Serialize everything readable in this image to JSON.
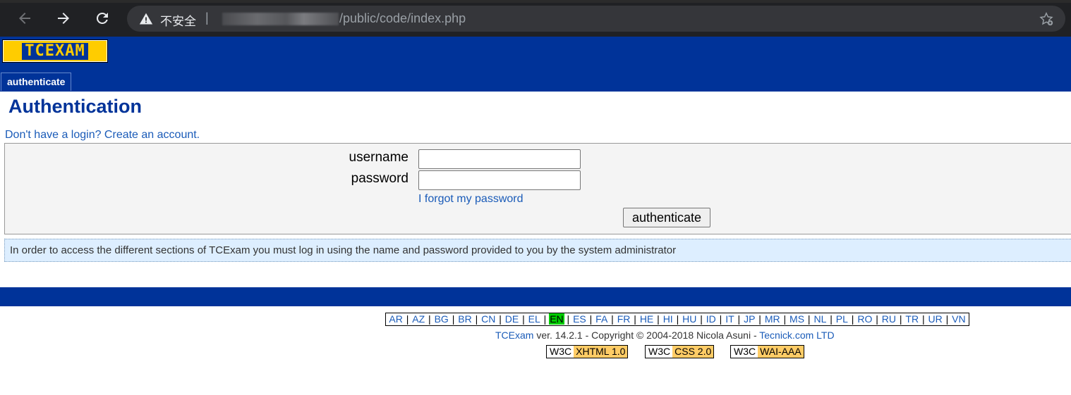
{
  "browser": {
    "security_label": "不安全",
    "separator": "|",
    "url_path": "/public/code/index.php"
  },
  "header": {
    "logo_text": "TCEXAM",
    "menu_tab": "authenticate"
  },
  "main": {
    "title": "Authentication",
    "create_account_link": "Don't have a login? Create an account.",
    "form": {
      "username_label": "username",
      "password_label": "password",
      "username_value": "",
      "password_value": "",
      "forgot_link": "I forgot my password",
      "submit_label": "authenticate"
    },
    "info_message": "In order to access the different sections of TCExam you must log in using the name and password provided to you by the system administrator"
  },
  "footer": {
    "languages": [
      "AR",
      "AZ",
      "BG",
      "BR",
      "CN",
      "DE",
      "EL",
      "EN",
      "ES",
      "FA",
      "FR",
      "HE",
      "HI",
      "HU",
      "ID",
      "IT",
      "JP",
      "MR",
      "MS",
      "NL",
      "PL",
      "RO",
      "RU",
      "TR",
      "UR",
      "VN"
    ],
    "active_language": "EN",
    "product_link": "TCExam",
    "version_text": " ver. 14.2.1 - Copyright © 2004-2018 Nicola Asuni - ",
    "company_link": "Tecnick.com LTD",
    "badges": [
      {
        "w3c": "W3C",
        "std": "XHTML 1.0"
      },
      {
        "w3c": "W3C",
        "std": "CSS 2.0"
      },
      {
        "w3c": "W3C",
        "std": "WAI-AAA"
      }
    ]
  },
  "colors": {
    "brand_blue": "#003399",
    "link_blue": "#1a5bb8",
    "logo_yellow": "#ffcc00",
    "active_lang_green": "#00cc00",
    "info_bg": "#ddeeff"
  }
}
